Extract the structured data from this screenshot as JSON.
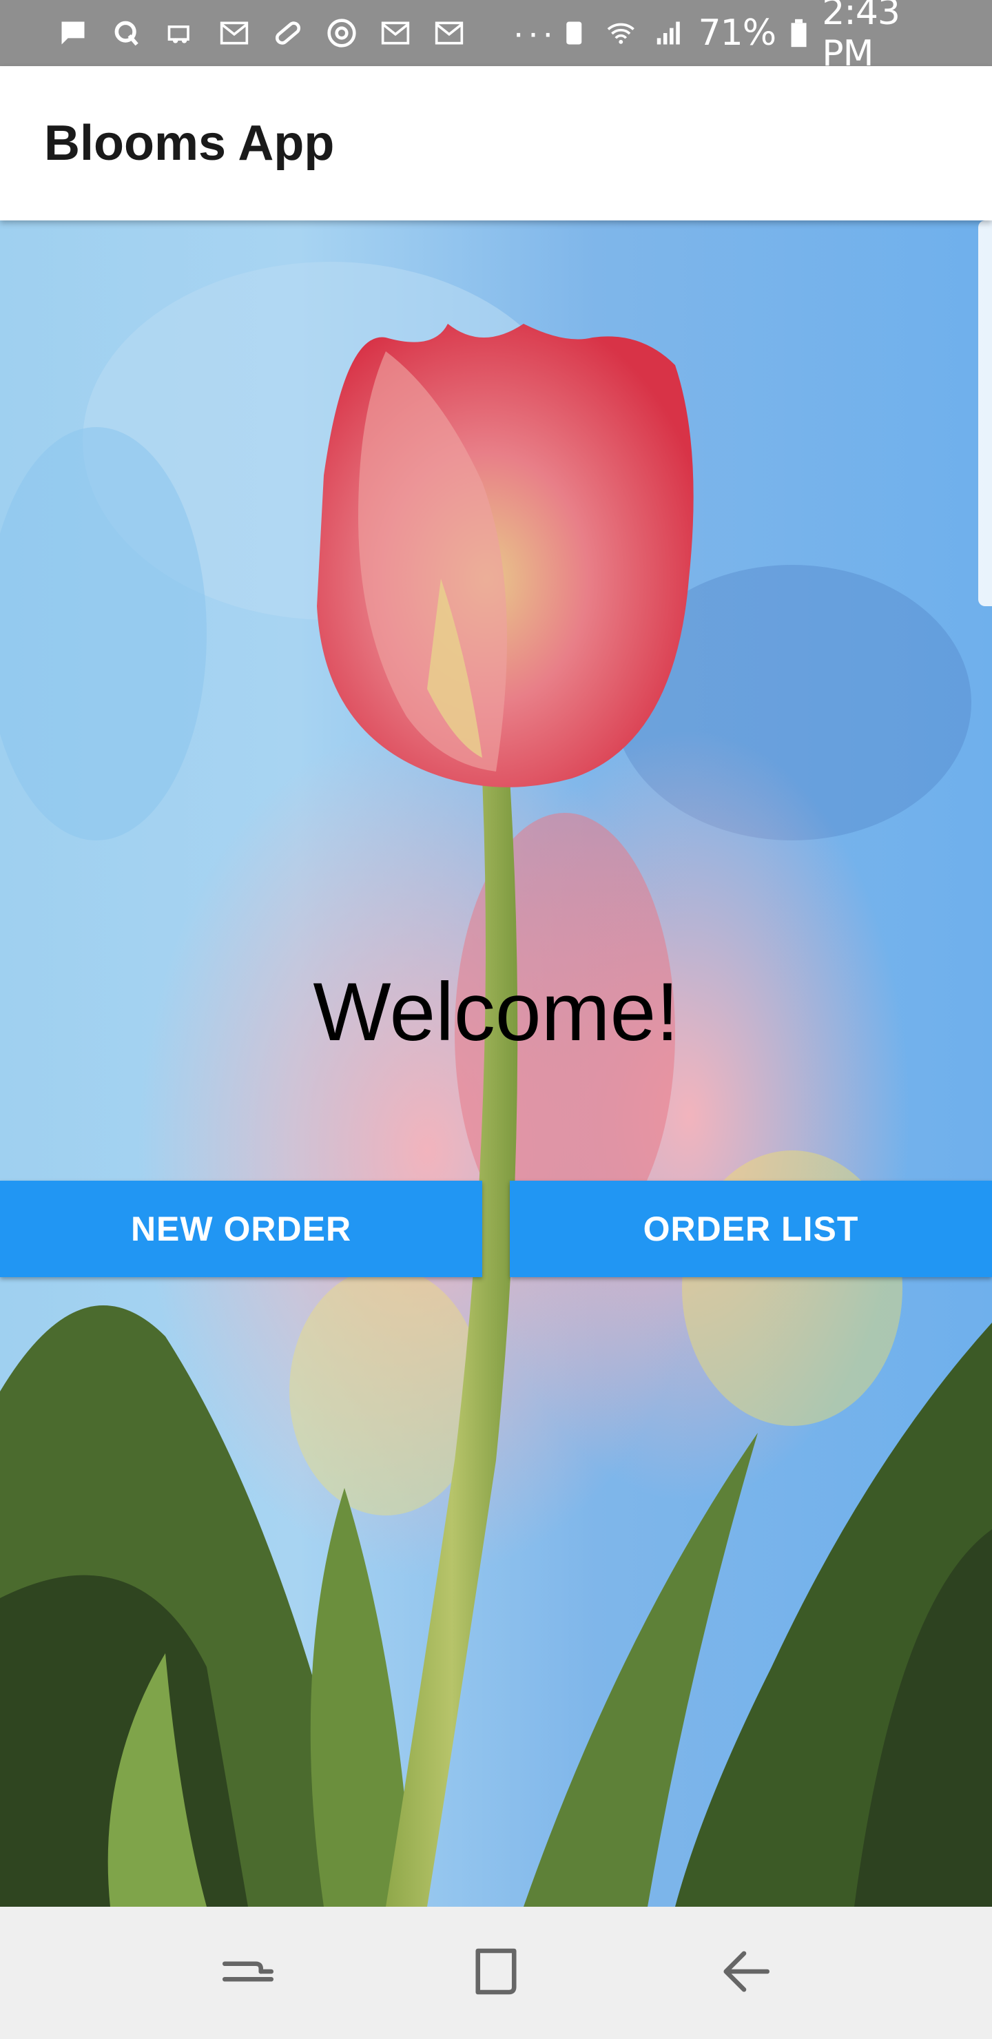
{
  "status_bar": {
    "battery": "71%",
    "time": "2:43 PM",
    "more": "···",
    "icons": [
      "message-icon",
      "q-icon",
      "cloud-icon",
      "mail-icon",
      "pill-icon",
      "chrome-icon",
      "mail-icon",
      "mail-icon",
      "recycle-icon",
      "wifi-icon",
      "signal-icon",
      "battery-icon"
    ]
  },
  "app_bar": {
    "title": "Blooms App"
  },
  "main": {
    "welcome": "Welcome!",
    "new_order_label": "NEW ORDER",
    "order_list_label": "ORDER LIST"
  },
  "nav_bar": {
    "icons": [
      "recents-icon",
      "home-icon",
      "back-icon"
    ]
  },
  "colors": {
    "status_bar": "#8f8f8f",
    "app_bar": "#ffffff",
    "button": "#2196f3",
    "nav_bar": "#efefef"
  }
}
